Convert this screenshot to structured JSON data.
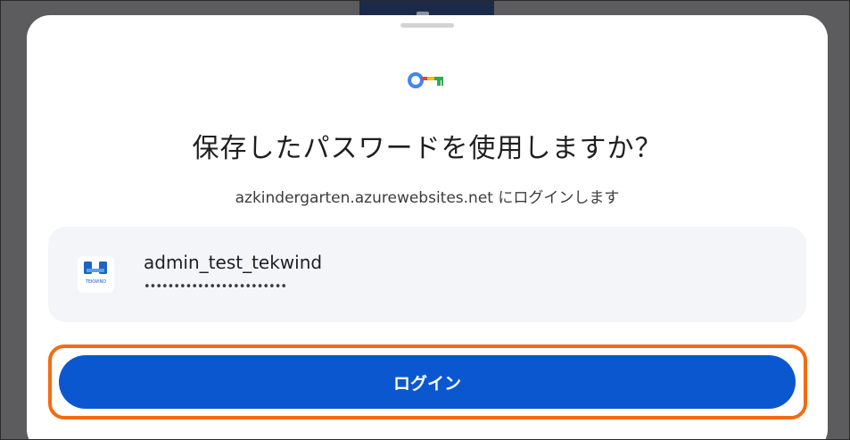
{
  "dialog": {
    "title": "保存したパスワードを使用しますか？",
    "subtitle": "azkindergarten.azurewebsites.net にログインします",
    "key_icon": "google-password-manager-key-icon"
  },
  "account": {
    "site_logo_icon": "tekwind-logo-icon",
    "site_logo_text": "TEKWIND",
    "username": "admin_test_tekwind",
    "password_mask": "••••••••••••••••••••••••"
  },
  "actions": {
    "login_label": "ログイン"
  },
  "colors": {
    "primary": "#0b57d0",
    "highlight": "#f36b12",
    "card": "#f4f5f9",
    "google_blue": "#4285f4",
    "google_red": "#ea4335",
    "google_yellow": "#fbbc04",
    "google_green": "#34a853"
  }
}
